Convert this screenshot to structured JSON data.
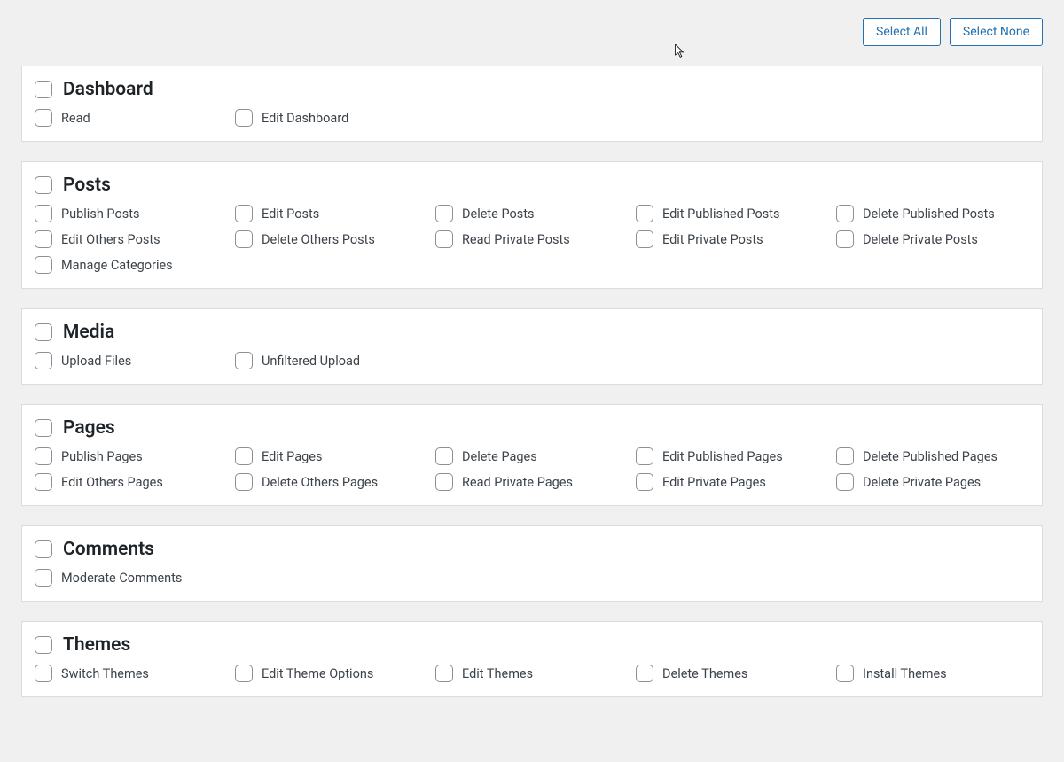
{
  "toolbar": {
    "select_all": "Select All",
    "select_none": "Select None"
  },
  "groups": [
    {
      "title": "Dashboard",
      "caps": [
        "Read",
        "Edit Dashboard"
      ]
    },
    {
      "title": "Posts",
      "caps": [
        "Publish Posts",
        "Edit Posts",
        "Delete Posts",
        "Edit Published Posts",
        "Delete Published Posts",
        "Edit Others Posts",
        "Delete Others Posts",
        "Read Private Posts",
        "Edit Private Posts",
        "Delete Private Posts",
        "Manage Categories"
      ]
    },
    {
      "title": "Media",
      "caps": [
        "Upload Files",
        "Unfiltered Upload"
      ]
    },
    {
      "title": "Pages",
      "caps": [
        "Publish Pages",
        "Edit Pages",
        "Delete Pages",
        "Edit Published Pages",
        "Delete Published Pages",
        "Edit Others Pages",
        "Delete Others Pages",
        "Read Private Pages",
        "Edit Private Pages",
        "Delete Private Pages"
      ]
    },
    {
      "title": "Comments",
      "caps": [
        "Moderate Comments"
      ]
    },
    {
      "title": "Themes",
      "caps": [
        "Switch Themes",
        "Edit Theme Options",
        "Edit Themes",
        "Delete Themes",
        "Install Themes"
      ]
    }
  ]
}
